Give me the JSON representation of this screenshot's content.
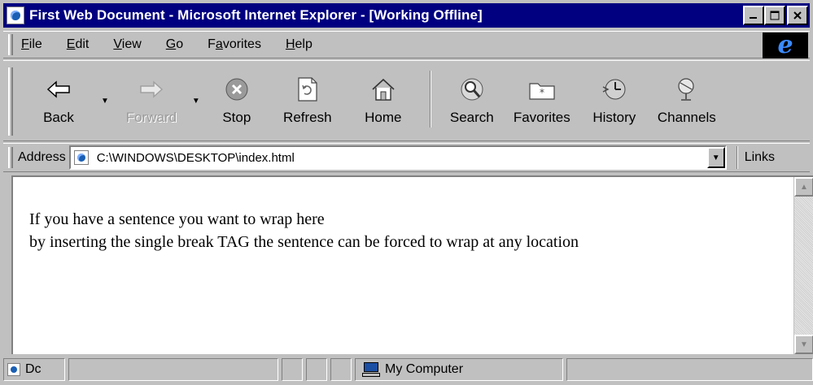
{
  "window": {
    "title": "First Web Document - Microsoft Internet Explorer - [Working Offline]"
  },
  "menu": {
    "items": [
      "File",
      "Edit",
      "View",
      "Go",
      "Favorites",
      "Help"
    ],
    "underline_letters": [
      "F",
      "E",
      "V",
      "G",
      "a",
      "H"
    ]
  },
  "toolbar": {
    "buttons": [
      {
        "label": "Back",
        "icon": "back-arrow-icon",
        "enabled": true
      },
      {
        "label": "Forward",
        "icon": "forward-arrow-icon",
        "enabled": false
      },
      {
        "label": "Stop",
        "icon": "stop-icon",
        "enabled": true
      },
      {
        "label": "Refresh",
        "icon": "refresh-icon",
        "enabled": true
      },
      {
        "label": "Home",
        "icon": "home-icon",
        "enabled": true
      },
      {
        "label": "Search",
        "icon": "search-icon",
        "enabled": true
      },
      {
        "label": "Favorites",
        "icon": "favorites-folder-icon",
        "enabled": true
      },
      {
        "label": "History",
        "icon": "history-icon",
        "enabled": true
      },
      {
        "label": "Channels",
        "icon": "channels-icon",
        "enabled": true
      }
    ]
  },
  "address": {
    "label": "Address",
    "value": "C:\\WINDOWS\\DESKTOP\\index.html",
    "links_label": "Links"
  },
  "document": {
    "line1": "If you have a sentence you want to wrap here",
    "line2": "by inserting the single break TAG the sentence can be forced to wrap at any location"
  },
  "status": {
    "main_text": "Dc",
    "zone_text": "My Computer"
  },
  "colors": {
    "titlebar": "#000080",
    "chrome": "#c0c0c0",
    "content_bg": "#ffffff"
  }
}
